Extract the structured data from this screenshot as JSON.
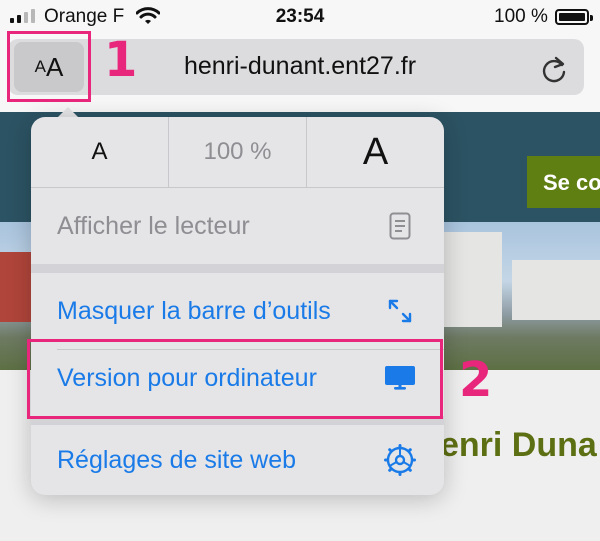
{
  "status_bar": {
    "carrier": "Orange F",
    "time": "23:54",
    "battery": "100 %"
  },
  "address_bar": {
    "text_size_button": {
      "small": "A",
      "large": "A"
    },
    "url": "henri-dunant.ent27.fr",
    "reload_icon": "reload-icon"
  },
  "page": {
    "login_button": "Se co",
    "school_name": "enri Duna"
  },
  "menu": {
    "zoom_row": {
      "smaller": "A",
      "percent": "100 %",
      "larger": "A"
    },
    "items": [
      {
        "label": "Afficher le lecteur",
        "icon": "reader-icon",
        "enabled": false
      },
      {
        "label": "Masquer la barre d’outils",
        "icon": "expand-arrows-icon",
        "enabled": true
      },
      {
        "label": "Version pour ordinateur",
        "icon": "desktop-icon",
        "enabled": true
      },
      {
        "label": "Réglages de site web",
        "icon": "gear-icon",
        "enabled": true
      }
    ]
  },
  "annotations": [
    {
      "number": "1",
      "color": "#e8267c"
    },
    {
      "number": "2",
      "color": "#e8267c"
    }
  ],
  "colors": {
    "accent": "#1a7be8",
    "annotation": "#e8267c",
    "site_header": "#2c5363",
    "site_green": "#5f7f13"
  }
}
